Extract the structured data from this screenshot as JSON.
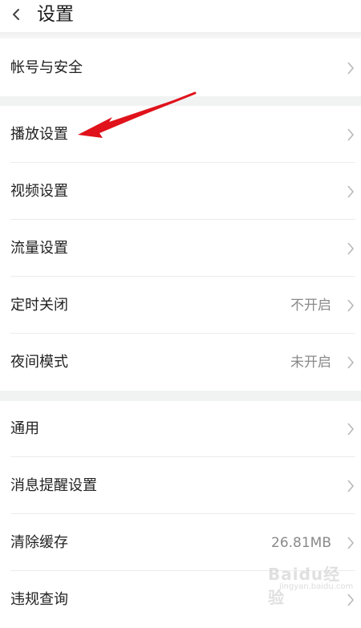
{
  "header": {
    "title": "设置",
    "back_icon": "chevron-left-icon"
  },
  "groups": [
    {
      "rows": [
        {
          "label": "帐号与安全",
          "value": ""
        }
      ]
    },
    {
      "rows": [
        {
          "label": "播放设置",
          "value": ""
        },
        {
          "label": "视频设置",
          "value": ""
        },
        {
          "label": "流量设置",
          "value": ""
        },
        {
          "label": "定时关闭",
          "value": "不开启"
        },
        {
          "label": "夜间模式",
          "value": "未开启"
        }
      ]
    },
    {
      "rows": [
        {
          "label": "通用",
          "value": ""
        },
        {
          "label": "消息提醒设置",
          "value": ""
        },
        {
          "label": "清除缓存",
          "value": "26.81MB"
        },
        {
          "label": "违规查询",
          "value": ""
        }
      ]
    }
  ],
  "annotation": {
    "arrow_color": "#e0121b",
    "points_to": "播放设置"
  },
  "watermark": {
    "text": "Baidu经验",
    "sub": "jingyan.baidu.com"
  },
  "colors": {
    "section_gap": "#f1f3f3",
    "text": "#222222",
    "secondary_text": "#8a8a8a",
    "chevron": "#b8b8b8"
  }
}
